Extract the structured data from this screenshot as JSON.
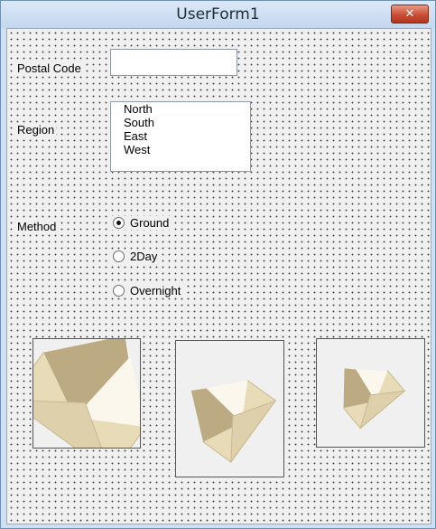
{
  "window": {
    "title": "UserForm1",
    "close_symbol": "✕"
  },
  "form": {
    "postal_code": {
      "label": "Postal Code",
      "value": ""
    },
    "region": {
      "label": "Region",
      "options": [
        "North",
        "South",
        "East",
        "West"
      ]
    },
    "method": {
      "label": "Method",
      "options": [
        {
          "label": "Ground",
          "selected": true
        },
        {
          "label": "2Day",
          "selected": false
        },
        {
          "label": "Overnight",
          "selected": false
        }
      ]
    }
  },
  "images": [
    {
      "icon": "envelope-icon"
    },
    {
      "icon": "envelope-icon"
    },
    {
      "icon": "envelope-icon"
    }
  ],
  "colors": {
    "envelope_front": "#e8dcb8",
    "envelope_flap": "#bcab82",
    "envelope_inner": "#fbf7ec"
  }
}
